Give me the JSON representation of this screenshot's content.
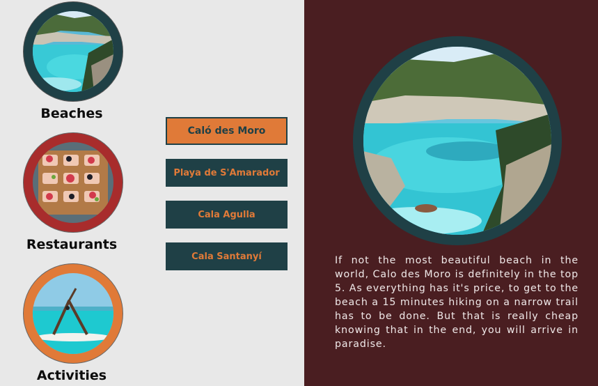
{
  "categories": [
    {
      "label": "Beaches",
      "icon": "beach-photo",
      "ring_color": "#1f4046"
    },
    {
      "label": "Restaurants",
      "icon": "food-photo",
      "ring_color": "#a82c2c"
    },
    {
      "label": "Activities",
      "icon": "yoga-photo",
      "ring_color": "#e07a38"
    }
  ],
  "beach_buttons": [
    {
      "label": "Caló des Moro",
      "active": true
    },
    {
      "label": "Playa de S'Amarador",
      "active": false
    },
    {
      "label": "Cala Agulla",
      "active": false
    },
    {
      "label": "Cala Santanyí",
      "active": false
    }
  ],
  "detail": {
    "image": "beach-photo",
    "description": "If not the most beautiful beach in the world, Calo des Moro is definitely in the top 5. As everything has it's price, to get to the beach a 15 minutes hiking on a narrow trail has to be done. But that is really cheap knowing that in the end, you will arrive in paradise."
  },
  "colors": {
    "left_bg": "#e8e8e8",
    "right_bg": "#4a1e21",
    "dark_teal": "#1f4046",
    "orange": "#e07a38",
    "red": "#a82c2c"
  }
}
